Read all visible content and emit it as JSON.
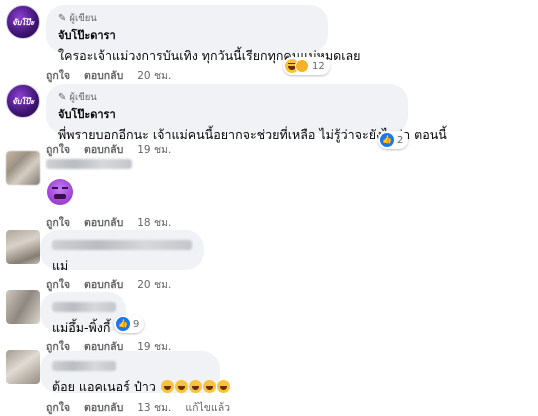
{
  "comments": [
    {
      "badge": "ผู้เขียน",
      "author": "จับโป๊ะดารา",
      "text": "ใครอะเจ้าแม่วงการบันเทิง ทุกวันนี้เรียกทุกคนแม่หมดเลย",
      "like": "ถูกใจ",
      "reply": "ตอบกลับ",
      "time": "20 ชม.",
      "reactions": "12",
      "avatar_text": "จับโป๊ะ"
    },
    {
      "badge": "ผู้เขียน",
      "author": "จับโป๊ะดารา",
      "text": "พี่พรายบอกอีกนะ เจ้าแม่คนนี้อยากจะช่วยที่เหลือ ไม่รู้ว่าจะยังไงต่อ ตอนนี้",
      "like": "ถูกใจ",
      "reply": "ตอบกลับ",
      "time": "19 ชม.",
      "reactions": "2",
      "avatar_text": "จับโป๊ะ"
    },
    {
      "like": "ถูกใจ",
      "reply": "ตอบกลับ",
      "time": "18 ชม.",
      "sticker": "tired-face-emoji"
    },
    {
      "text": "แม่",
      "like": "ถูกใจ",
      "reply": "ตอบกลับ",
      "time": "20 ชม."
    },
    {
      "text": "แม่อึ้ม-พิ้งกี้",
      "like": "ถูกใจ",
      "reply": "ตอบกลับ",
      "time": "19 ชม.",
      "reactions": "9"
    },
    {
      "text": "ต้อย แอคเนอร์ ป๋าว",
      "like": "ถูกใจ",
      "reply": "ตอบกลับ",
      "time": "13 ชม.",
      "edited": "แก้ไขแล้ว"
    }
  ],
  "colors": {
    "bubble": "#f0f2f5",
    "meta_text": "#65676b",
    "like_blue": "#1877f2",
    "haha_yellow": "#f7c23c"
  }
}
